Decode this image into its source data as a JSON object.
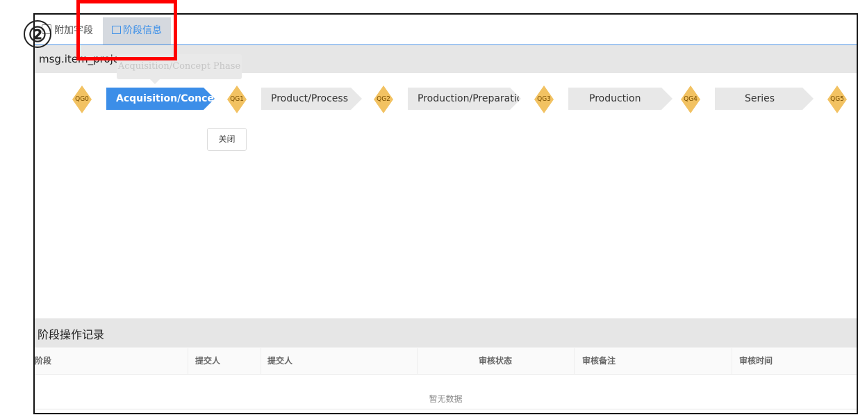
{
  "tabs": {
    "extra_fields": "附加字段",
    "stage_info": "阶段信息"
  },
  "project": {
    "name": "msg.item_project_name"
  },
  "tooltip": "Acquisition/Concept Phase",
  "gates": [
    "QG0",
    "QG1",
    "QG2",
    "QG3",
    "QG4",
    "QG5"
  ],
  "phases": [
    {
      "label": "Acquisition/Concept Phase",
      "active": true
    },
    {
      "label": "Product/Process",
      "active": false
    },
    {
      "label": "Production/Preparation",
      "active": false
    },
    {
      "label": "Production",
      "active": false
    },
    {
      "label": "Series",
      "active": false
    }
  ],
  "close_label": "关闭",
  "records": {
    "title": "阶段操作记录",
    "columns": [
      "阶段",
      "提交人",
      "提交人",
      "审核状态",
      "审核备注",
      "审核时间"
    ],
    "empty_text": "暂无数据"
  },
  "annotation": {
    "marker": "②",
    "highlight_color": "#ff0000"
  }
}
